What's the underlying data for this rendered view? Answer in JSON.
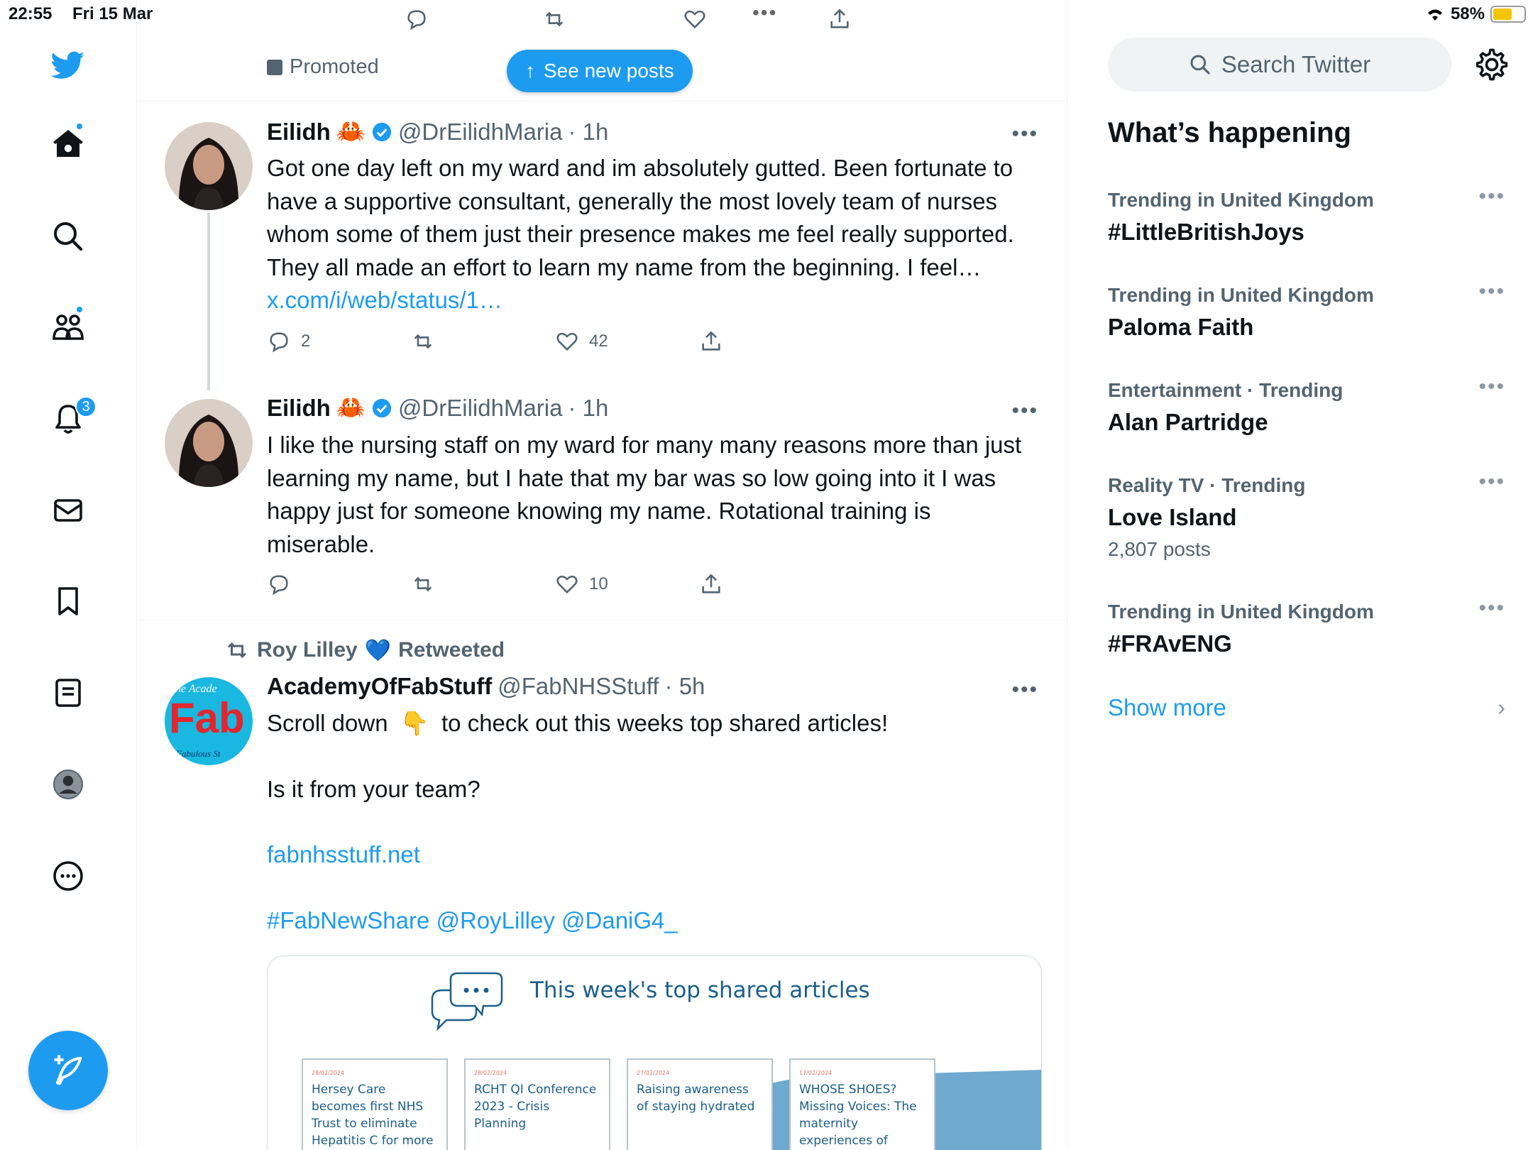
{
  "status_bar": {
    "time": "22:55",
    "date": "Fri 15 Mar",
    "battery": "58%",
    "multitask_dots": "•••"
  },
  "nav": {
    "notifications_badge": "3"
  },
  "timeline": {
    "promoted_label": "Promoted",
    "see_new_posts": "See new posts",
    "tweets": [
      {
        "name": "Eilidh",
        "emoji": "🦀",
        "handle": "@DrEilidhMaria",
        "time": "· 1h",
        "text": "Got one day left on my ward and im absolutely gutted. Been fortunate to have a supportive consultant, generally the most lovely team of nurses whom some of them just their presence makes me feel really supported. They all made an effort to learn my name from the beginning. I feel…",
        "link": "x.com/i/web/status/1…",
        "replies": "2",
        "retweets": "",
        "likes": "42"
      },
      {
        "name": "Eilidh",
        "emoji": "🦀",
        "handle": "@DrEilidhMaria",
        "time": "· 1h",
        "text": "I like the nursing staff on my ward for many many reasons more than just learning my name, but I hate that my bar was so low going into it I was happy just for someone knowing my name. Rotational training is miserable.",
        "replies": "",
        "retweets": "",
        "likes": "10"
      },
      {
        "retweeted_by": "Roy Lilley",
        "retweeted_emoji": "💙",
        "retweeted_label": "Retweeted",
        "name": "AcademyOfFabStuff",
        "handle": "@FabNHSStuff",
        "time": "· 5h",
        "line1a": "Scroll down",
        "line1_emoji": "👇",
        "line1b": "to check out this weeks top shared articles!",
        "line2": "Is it from your team?",
        "site_link": "fabnhsstuff.net",
        "hashtags": "#FabNewShare @RoyLilley @DaniG4_",
        "card": {
          "title": "This week's top shared articles",
          "articles": [
            {
              "date": "28/02/2024",
              "title": "Hersey Care becomes first NHS Trust to eliminate Hepatitis C for more than six"
            },
            {
              "date": "28/02/2024",
              "title": "RCHT QI Conference 2023 - Crisis Planning"
            },
            {
              "date": "27/02/2024",
              "title": "Raising awareness of staying hydrated"
            },
            {
              "date": "17/02/2024",
              "title": "WHOSE SHOES? Missing Voices: The maternity experiences of Black, Asian and minority"
            }
          ]
        },
        "avatar_text_top": "The Acade",
        "avatar_text_mid": "Fab",
        "avatar_text_bot": "Fabulous St"
      }
    ]
  },
  "sidebar": {
    "search_placeholder": "Search Twitter",
    "heading": "What’s happening",
    "trends": [
      {
        "context": "Trending in United Kingdom",
        "name": "#LittleBritishJoys",
        "count": ""
      },
      {
        "context": "Trending in United Kingdom",
        "name": "Paloma Faith",
        "count": ""
      },
      {
        "context": "Entertainment · Trending",
        "name": "Alan Partridge",
        "count": ""
      },
      {
        "context": "Reality TV · Trending",
        "name": "Love Island",
        "count": "2,807 posts"
      },
      {
        "context": "Trending in United Kingdom",
        "name": "#FRAvENG",
        "count": ""
      }
    ],
    "show_more": "Show more"
  },
  "colors": {
    "accent": "#1d9bf0",
    "text": "#0f1419",
    "muted": "#536471"
  }
}
